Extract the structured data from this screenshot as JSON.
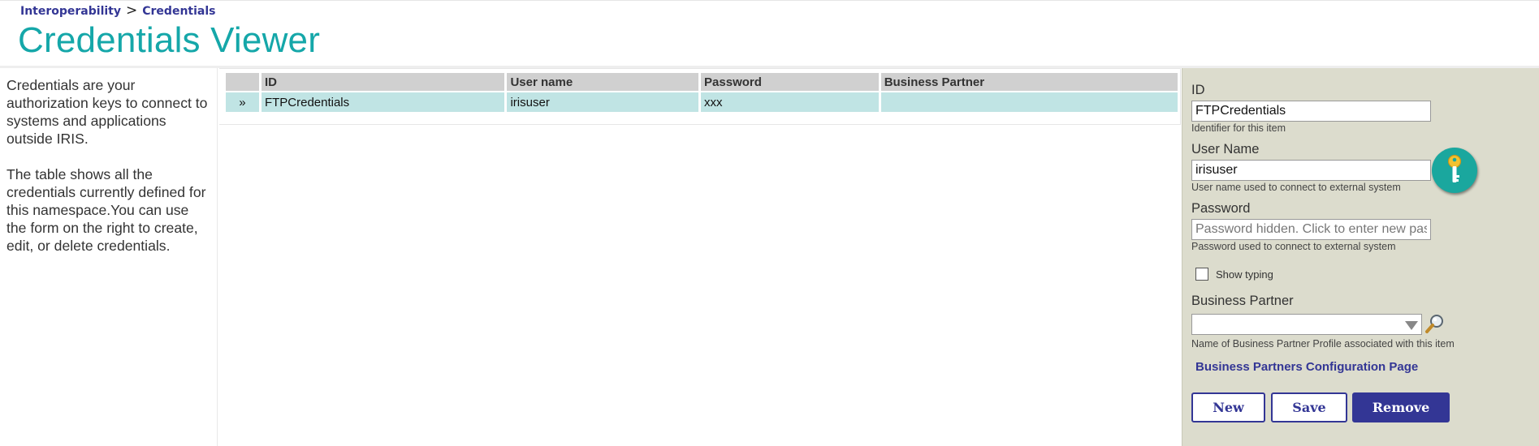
{
  "breadcrumb": {
    "parent": "Interoperability",
    "separator": ">",
    "current": "Credentials"
  },
  "page": {
    "title": "Credentials Viewer"
  },
  "description": {
    "para1": "Credentials are your authorization keys to connect to systems and applications outside IRIS.",
    "para2": "The table shows all the credentials currently defined for this namespace.You can use the form on the right to create, edit, or delete credentials."
  },
  "table": {
    "columns": [
      "",
      "ID",
      "User name",
      "Password",
      "Business Partner"
    ],
    "rows": [
      {
        "selector": "»",
        "id": "FTPCredentials",
        "username": "irisuser",
        "password": "xxx",
        "partner": ""
      }
    ]
  },
  "form": {
    "id_label": "ID",
    "id_value": "FTPCredentials",
    "id_hint": "Identifier for this item",
    "username_label": "User Name",
    "username_value": "irisuser",
    "username_hint": "User name used to connect to external system",
    "password_label": "Password",
    "password_placeholder": "Password hidden. Click to enter new password",
    "password_hint": "Password used to connect to external system",
    "show_typing_label": "Show typing",
    "show_typing_checked": false,
    "partner_label": "Business Partner",
    "partner_value": "",
    "partner_hint": "Name of Business Partner Profile associated with this item",
    "partners_link": "Business Partners Configuration Page",
    "buttons": {
      "new": "New",
      "save": "Save",
      "remove": "Remove"
    }
  },
  "icons": {
    "key": "key-icon",
    "search": "magnifier-icon",
    "dropdown": "chevron-down-icon"
  },
  "colors": {
    "title": "#15a7a9",
    "accent": "#333695",
    "selected_row": "#c0e4e4",
    "panel_bg": "#dcdccd",
    "key_button": "#1aa79e"
  }
}
